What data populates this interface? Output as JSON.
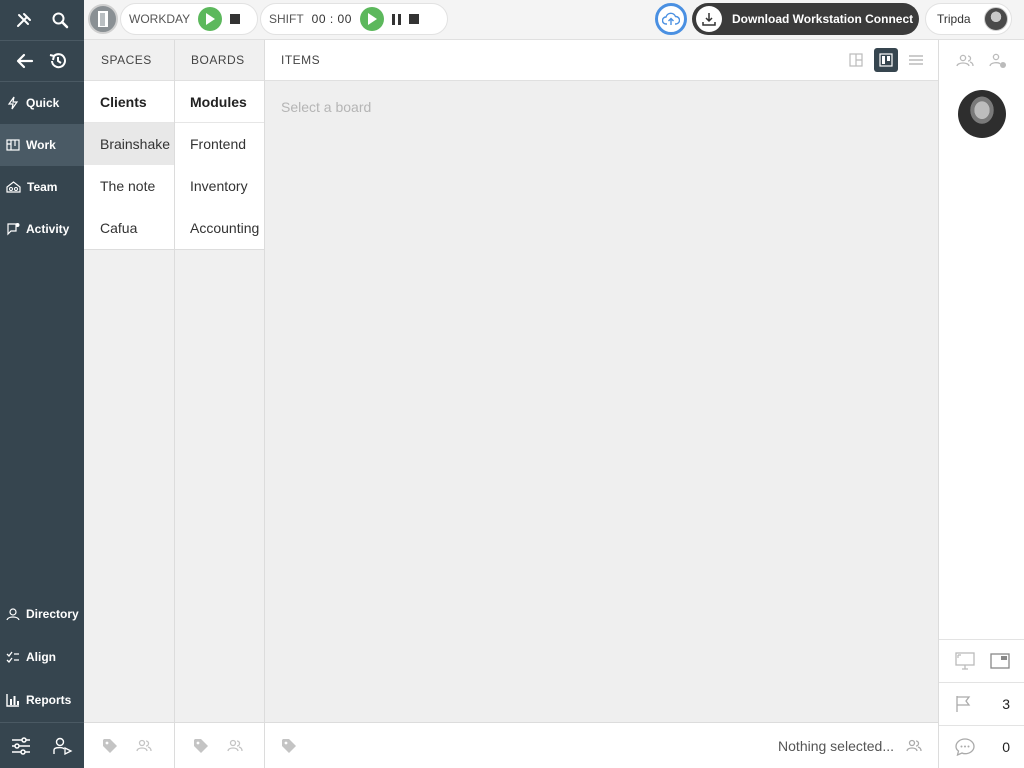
{
  "topbar": {
    "workday_label": "WORKDAY",
    "shift_label": "SHIFT",
    "shift_timer": "00 : 00",
    "download_label": "Download Workstation Connect",
    "user_name": "Tripda"
  },
  "sidebar": {
    "nav": [
      {
        "label": "Quick",
        "icon": "lightning-icon"
      },
      {
        "label": "Work",
        "icon": "board-icon",
        "active": true
      },
      {
        "label": "Team",
        "icon": "team-icon"
      },
      {
        "label": "Activity",
        "icon": "activity-icon"
      }
    ],
    "bottom_nav": [
      {
        "label": "Directory",
        "icon": "directory-icon"
      },
      {
        "label": "Align",
        "icon": "checklist-icon"
      },
      {
        "label": "Reports",
        "icon": "bar-chart-icon"
      }
    ]
  },
  "spaces": {
    "header": "SPACES",
    "heading": "Clients",
    "items": [
      "Brainshake",
      "The note",
      "Cafua"
    ],
    "selected": "Brainshake"
  },
  "boards": {
    "header": "BOARDS",
    "heading": "Modules",
    "items": [
      "Frontend",
      "Inventory",
      "Accounting"
    ]
  },
  "items": {
    "header": "ITEMS",
    "placeholder": "Select a board",
    "footer_status": "Nothing selected..."
  },
  "right_panel": {
    "flag_count": "3",
    "comment_count": "0"
  },
  "colors": {
    "sidebar_bg": "#36454f",
    "play_green": "#5cb85c",
    "cloud_blue": "#4a90e2",
    "download_bg": "#3b3b3b"
  }
}
